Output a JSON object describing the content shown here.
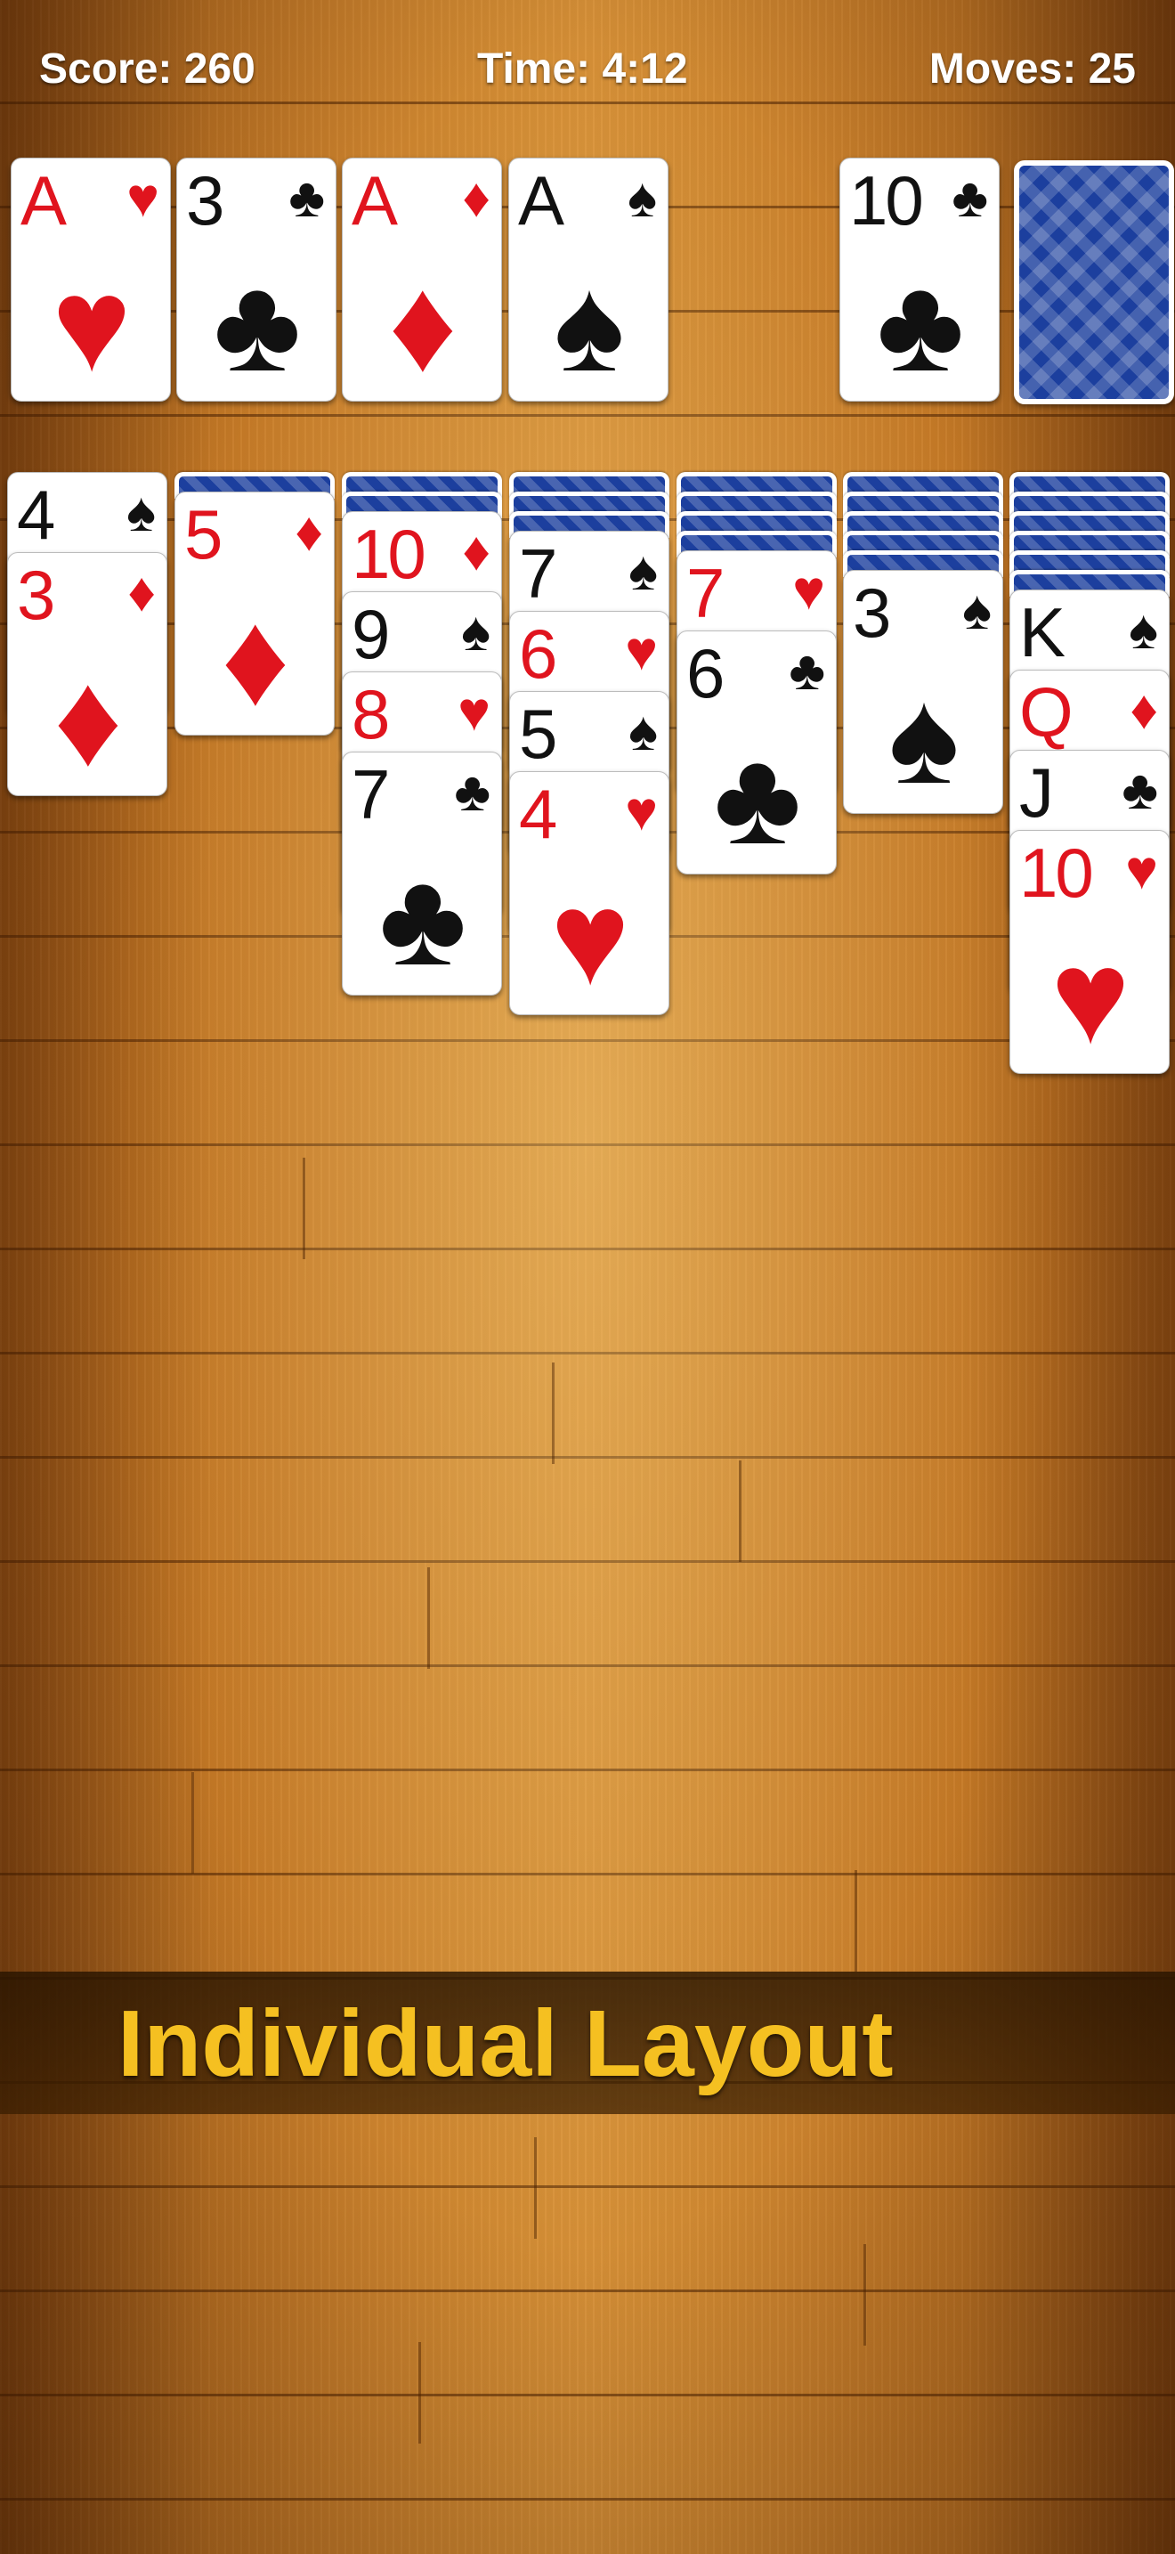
{
  "hud": {
    "score": "Score: 260",
    "time": "Time: 4:12",
    "moves": "Moves: 25"
  },
  "colors": {
    "red": "#e0141e",
    "black": "#111111",
    "card_back": "#1c3f9e",
    "banner_text": "#f5c021"
  },
  "foundations": [
    {
      "rank": "A",
      "suit": "♥",
      "color": "red"
    },
    {
      "rank": "3",
      "suit": "♣",
      "color": "black"
    },
    {
      "rank": "A",
      "suit": "♦",
      "color": "red"
    },
    {
      "rank": "A",
      "suit": "♠",
      "color": "black"
    }
  ],
  "waste": {
    "rank": "10",
    "suit": "♣",
    "color": "black"
  },
  "stock": {
    "face_down": true
  },
  "tableau": [
    {
      "hidden": 0,
      "cards": [
        {
          "rank": "4",
          "suit": "♠",
          "color": "black"
        },
        {
          "rank": "3",
          "suit": "♦",
          "color": "red"
        }
      ]
    },
    {
      "hidden": 1,
      "cards": [
        {
          "rank": "5",
          "suit": "♦",
          "color": "red"
        }
      ]
    },
    {
      "hidden": 2,
      "cards": [
        {
          "rank": "10",
          "suit": "♦",
          "color": "red"
        },
        {
          "rank": "9",
          "suit": "♠",
          "color": "black"
        },
        {
          "rank": "8",
          "suit": "♥",
          "color": "red"
        },
        {
          "rank": "7",
          "suit": "♣",
          "color": "black"
        }
      ]
    },
    {
      "hidden": 3,
      "cards": [
        {
          "rank": "7",
          "suit": "♠",
          "color": "black"
        },
        {
          "rank": "6",
          "suit": "♥",
          "color": "red"
        },
        {
          "rank": "5",
          "suit": "♠",
          "color": "black"
        },
        {
          "rank": "4",
          "suit": "♥",
          "color": "red"
        }
      ]
    },
    {
      "hidden": 4,
      "cards": [
        {
          "rank": "7",
          "suit": "♥",
          "color": "red"
        },
        {
          "rank": "6",
          "suit": "♣",
          "color": "black"
        }
      ]
    },
    {
      "hidden": 5,
      "cards": [
        {
          "rank": "3",
          "suit": "♠",
          "color": "black"
        }
      ]
    },
    {
      "hidden": 6,
      "cards": [
        {
          "rank": "K",
          "suit": "♠",
          "color": "black"
        },
        {
          "rank": "Q",
          "suit": "♦",
          "color": "red"
        },
        {
          "rank": "J",
          "suit": "♣",
          "color": "black"
        },
        {
          "rank": "10",
          "suit": "♥",
          "color": "red"
        }
      ]
    }
  ],
  "banner": {
    "text": "Individual Layout"
  }
}
